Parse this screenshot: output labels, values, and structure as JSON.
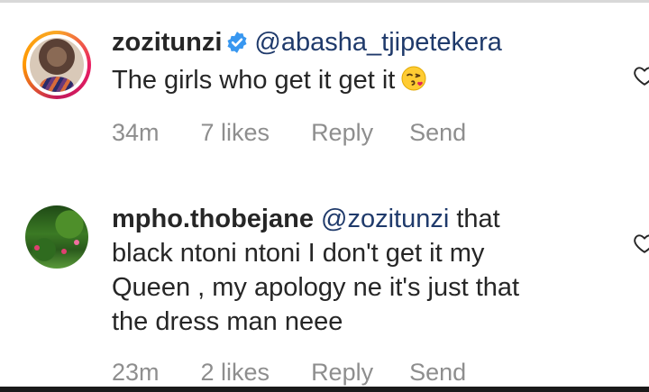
{
  "comments": [
    {
      "username": "zozitunzi",
      "verified": true,
      "mention": "@abasha_tjipetekera",
      "text": "The girls who get it get it",
      "emoji": "face-blowing-kiss",
      "time": "34m",
      "likes": "7 likes",
      "reply": "Reply",
      "send": "Send"
    },
    {
      "username": "mpho.thobejane",
      "verified": false,
      "mention": "@zozitunzi",
      "text_line1": " that",
      "text_line2": "black ntoni ntoni I don't get it my",
      "text_line3": "Queen , my apology ne it's just that",
      "text_line4": "the dress man neee",
      "time": "23m",
      "likes": "2 likes",
      "reply": "Reply",
      "send": "Send"
    }
  ],
  "colors": {
    "text": "#262626",
    "meta": "#8e8e8e",
    "mention": "#1f3a6b",
    "verified": "#3897f0"
  }
}
